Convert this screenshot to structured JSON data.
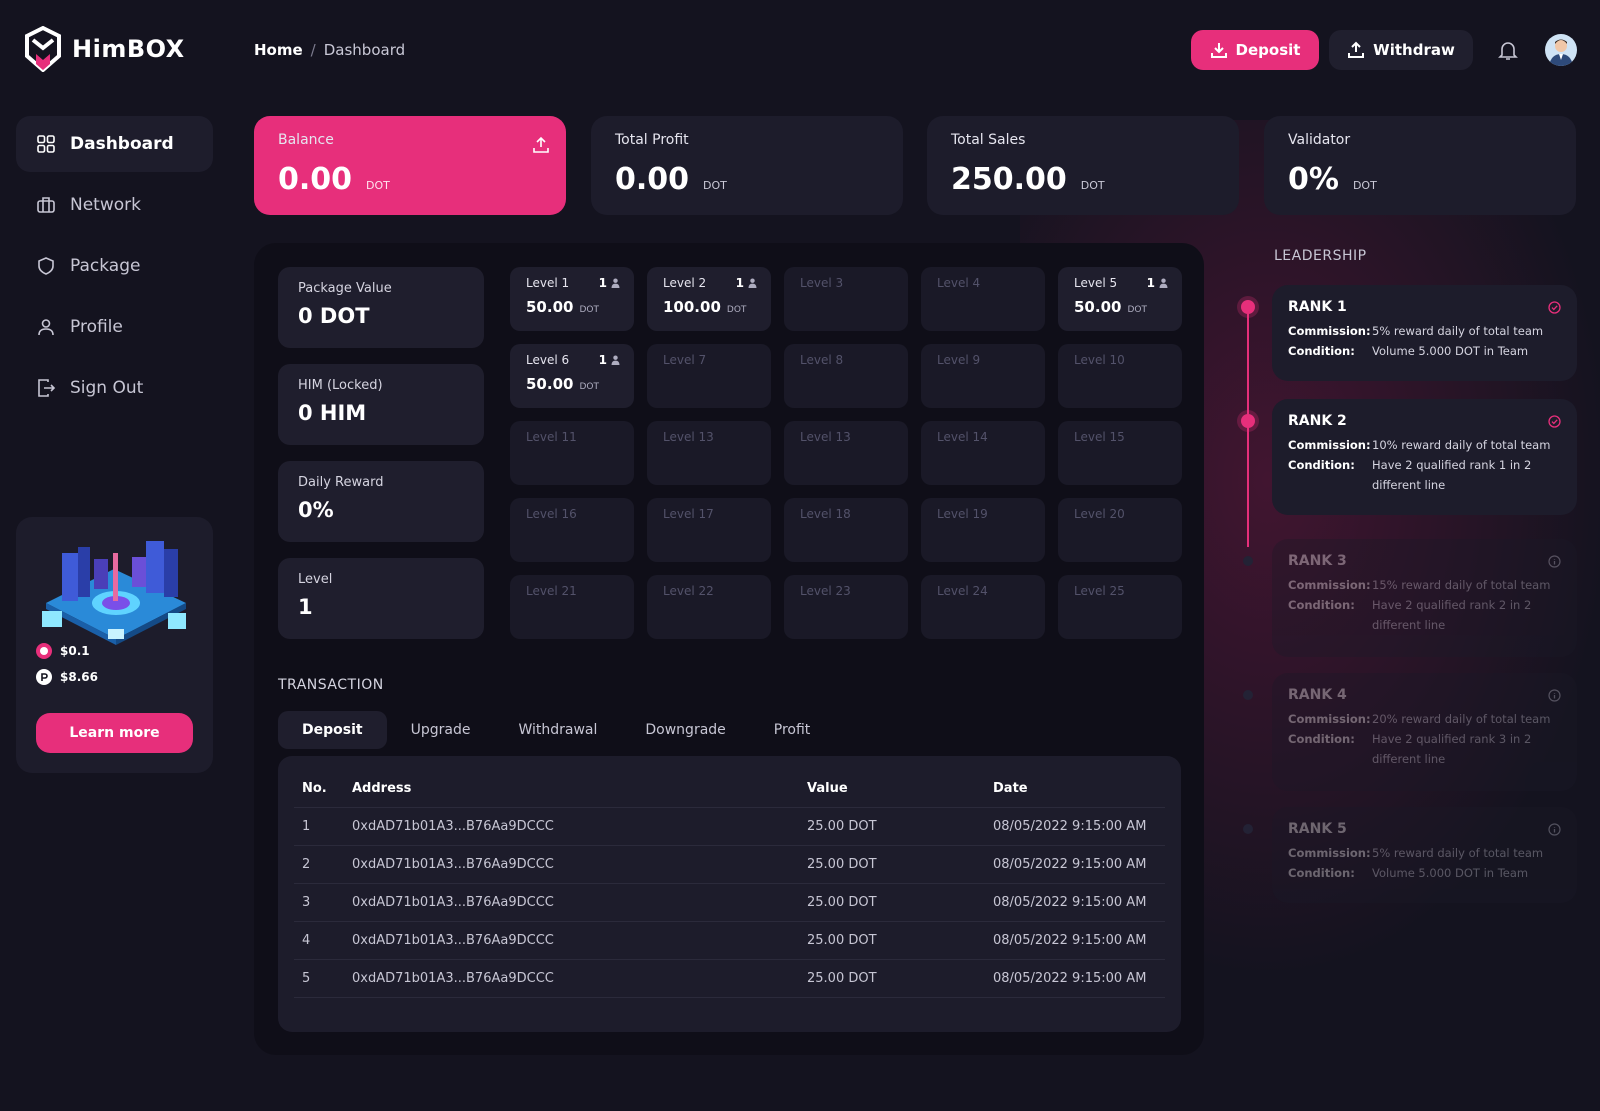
{
  "brand": {
    "name": "HimBOX",
    "accent": "#e72f7b"
  },
  "breadcrumb": {
    "home": "Home",
    "sep": "/",
    "current": "Dashboard"
  },
  "header": {
    "deposit_label": "Deposit",
    "withdraw_label": "Withdraw"
  },
  "nav": {
    "items": [
      {
        "label": "Dashboard",
        "icon": "grid-icon",
        "active": true
      },
      {
        "label": "Network",
        "icon": "briefcase-icon"
      },
      {
        "label": "Package",
        "icon": "shield-icon"
      },
      {
        "label": "Profile",
        "icon": "user-icon"
      },
      {
        "label": "Sign Out",
        "icon": "logout-icon"
      }
    ]
  },
  "promo": {
    "price1": "$0.1",
    "price2": "$8.66",
    "button": "Learn more"
  },
  "stats": [
    {
      "label": "Balance",
      "value": "0.00",
      "unit": "DOT"
    },
    {
      "label": "Total Profit",
      "value": "0.00",
      "unit": "DOT"
    },
    {
      "label": "Total Sales",
      "value": "250.00",
      "unit": "DOT"
    },
    {
      "label": "Validator",
      "value": "0%",
      "unit": "DOT"
    }
  ],
  "info": [
    {
      "label": "Package Value",
      "value": "0 DOT"
    },
    {
      "label": "HIM (Locked)",
      "value": "0 HIM"
    },
    {
      "label": "Daily Reward",
      "value": "0%"
    },
    {
      "label": "Level",
      "value": "1"
    }
  ],
  "levels": [
    {
      "name": "Level 1",
      "count": "1",
      "amount": "50.00",
      "unit": "DOT"
    },
    {
      "name": "Level 2",
      "count": "1",
      "amount": "100.00",
      "unit": "DOT"
    },
    {
      "name": "Level 3"
    },
    {
      "name": "Level 4"
    },
    {
      "name": "Level 5",
      "count": "1",
      "amount": "50.00",
      "unit": "DOT"
    },
    {
      "name": "Level 6",
      "count": "1",
      "amount": "50.00",
      "unit": "DOT"
    },
    {
      "name": "Level 7"
    },
    {
      "name": "Level 8"
    },
    {
      "name": "Level 9"
    },
    {
      "name": "Level 10"
    },
    {
      "name": "Level 11"
    },
    {
      "name": "Level 13"
    },
    {
      "name": "Level 13"
    },
    {
      "name": "Level 14"
    },
    {
      "name": "Level 15"
    },
    {
      "name": "Level 16"
    },
    {
      "name": "Level 17"
    },
    {
      "name": "Level 18"
    },
    {
      "name": "Level 19"
    },
    {
      "name": "Level 20"
    },
    {
      "name": "Level 21"
    },
    {
      "name": "Level 22"
    },
    {
      "name": "Level 23"
    },
    {
      "name": "Level 24"
    },
    {
      "name": "Level 25"
    }
  ],
  "transaction": {
    "title": "TRANSACTION",
    "tabs": [
      "Deposit",
      "Upgrade",
      "Withdrawal",
      "Downgrade",
      "Profit"
    ],
    "columns": [
      "No.",
      "Address",
      "Value",
      "Date"
    ],
    "rows": [
      [
        "1",
        "0xdAD71b01A3...B76Aa9DCCC",
        "25.00 DOT",
        "08/05/2022 9:15:00 AM"
      ],
      [
        "2",
        "0xdAD71b01A3...B76Aa9DCCC",
        "25.00 DOT",
        "08/05/2022 9:15:00 AM"
      ],
      [
        "3",
        "0xdAD71b01A3...B76Aa9DCCC",
        "25.00 DOT",
        "08/05/2022 9:15:00 AM"
      ],
      [
        "4",
        "0xdAD71b01A3...B76Aa9DCCC",
        "25.00 DOT",
        "08/05/2022 9:15:00 AM"
      ],
      [
        "5",
        "0xdAD71b01A3...B76Aa9DCCC",
        "25.00 DOT",
        "08/05/2022 9:15:00 AM"
      ]
    ]
  },
  "leadership": {
    "title": "LEADERSHIP",
    "commission_label": "Commission:",
    "condition_label": "Condition:",
    "ranks": [
      {
        "name": "RANK 1",
        "commission": "5% reward daily of total team",
        "condition": "Volume 5.000 DOT in Team",
        "achieved": true
      },
      {
        "name": "RANK 2",
        "commission": "10% reward daily of total team",
        "condition": "Have 2 qualified rank 1 in 2 different line",
        "achieved": true
      },
      {
        "name": "RANK 3",
        "commission": "15% reward daily of total team",
        "condition": "Have 2 qualified rank 2 in 2 different line",
        "achieved": false
      },
      {
        "name": "RANK 4",
        "commission": "20% reward daily of total team",
        "condition": "Have 2 qualified rank 3 in 2 different line",
        "achieved": false
      },
      {
        "name": "RANK 5",
        "commission": "5% reward daily of total team",
        "condition": "Volume 5.000 DOT in Team",
        "achieved": false
      }
    ]
  }
}
